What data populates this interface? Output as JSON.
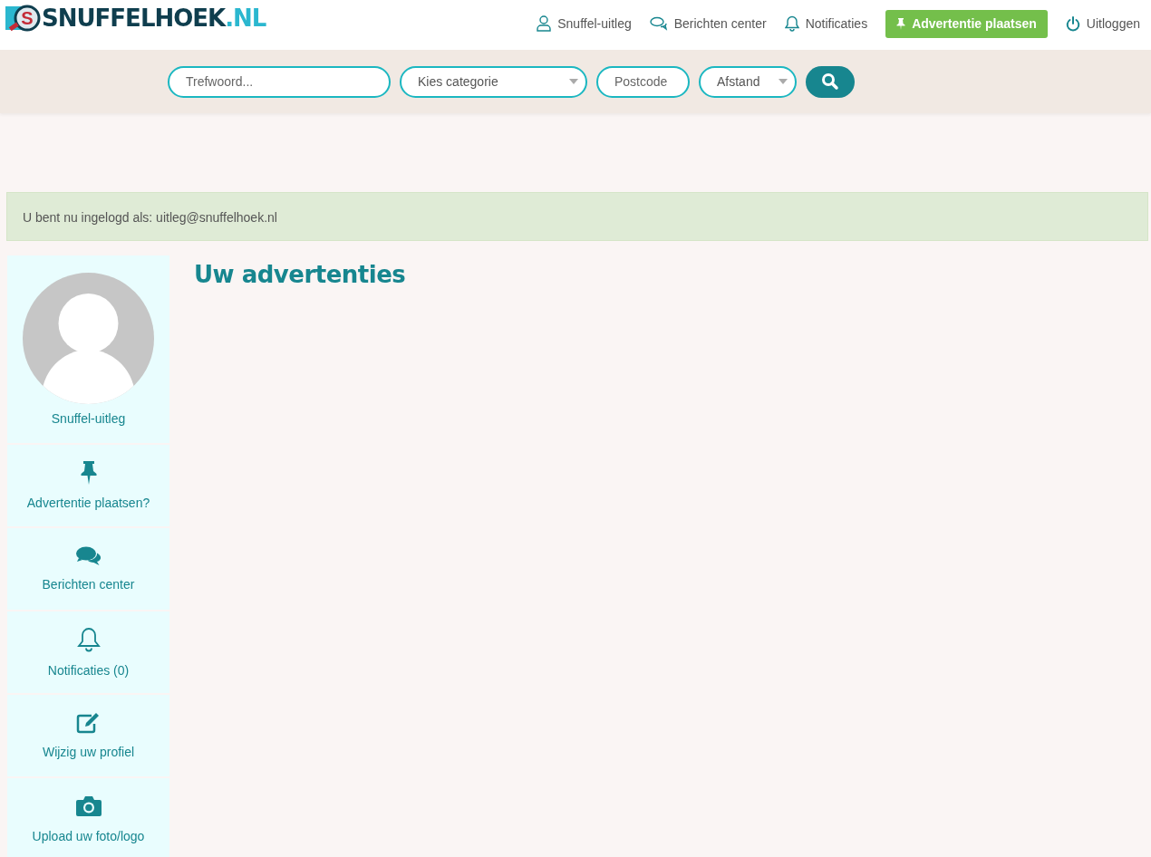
{
  "logo": {
    "mark": "S",
    "main": "SNUFFELHOEK",
    "suffix": ".NL"
  },
  "nav": [
    {
      "kind": "user",
      "label": "Snuffel-uitleg"
    },
    {
      "kind": "chat",
      "label": "Berichten center"
    },
    {
      "kind": "bell",
      "label": "Notificaties"
    },
    {
      "kind": "cta",
      "label": "Advertentie plaatsen"
    },
    {
      "kind": "power",
      "label": "Uitloggen"
    }
  ],
  "search": {
    "keyword": {
      "placeholder": "Trefwoord..."
    },
    "category": {
      "value": "Kies categorie"
    },
    "postcode": {
      "placeholder": "Postcode"
    },
    "distance": {
      "value": "Afstand"
    }
  },
  "alert": "U bent nu ingelogd als: uitleg@snuffelhoek.nl",
  "profile": {
    "name": "Snuffel-uitleg"
  },
  "sidebar": {
    "items": [
      {
        "kind": "pin",
        "label": "Advertentie plaatsen?"
      },
      {
        "kind": "chat",
        "label": "Berichten center"
      },
      {
        "kind": "bell",
        "label": "Notificaties (0)"
      },
      {
        "kind": "edit",
        "label": "Wijzig uw profiel"
      },
      {
        "kind": "camera",
        "label": "Upload uw foto/logo"
      }
    ]
  },
  "heading": "Uw advertenties"
}
